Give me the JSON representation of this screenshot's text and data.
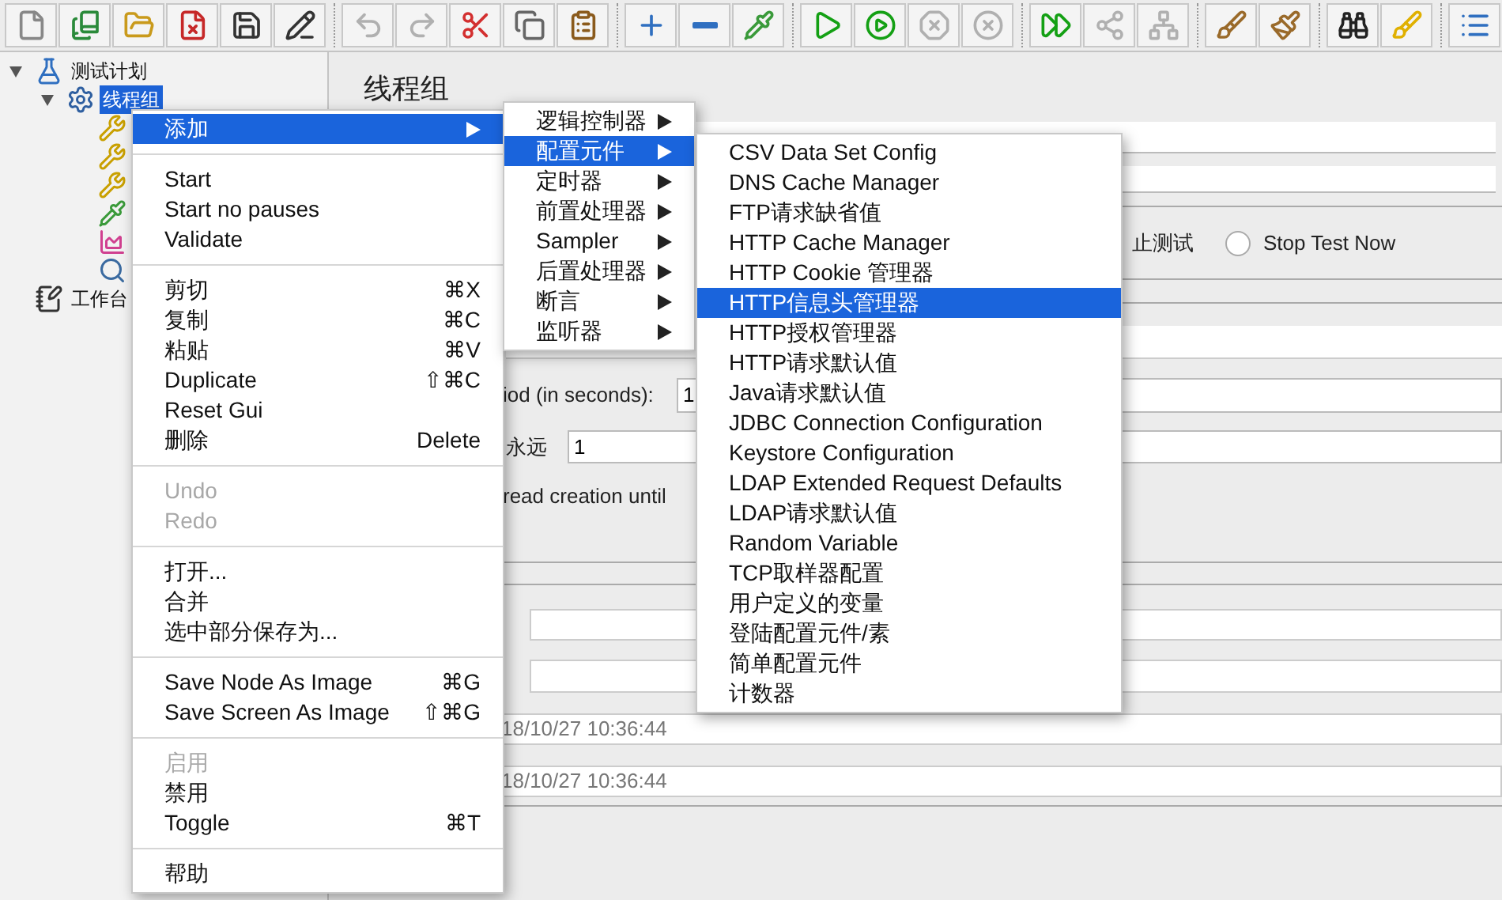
{
  "toolbar": [
    {
      "buttons": [
        {
          "kind": "new",
          "disabled": false
        },
        {
          "kind": "templates",
          "disabled": false
        },
        {
          "kind": "open",
          "disabled": false
        },
        {
          "kind": "close",
          "disabled": false
        },
        {
          "kind": "save",
          "disabled": false
        },
        {
          "kind": "save_as",
          "disabled": false
        }
      ]
    },
    {
      "buttons": [
        {
          "kind": "undo",
          "disabled": true
        },
        {
          "kind": "redo",
          "disabled": true
        },
        {
          "kind": "cut",
          "disabled": false
        },
        {
          "kind": "copy",
          "disabled": false
        },
        {
          "kind": "paste",
          "disabled": false
        }
      ]
    },
    {
      "buttons": [
        {
          "kind": "expand",
          "disabled": false
        },
        {
          "kind": "collapse",
          "disabled": false
        },
        {
          "kind": "toggle",
          "disabled": false
        }
      ]
    },
    {
      "buttons": [
        {
          "kind": "start",
          "disabled": false
        },
        {
          "kind": "start_no_pause",
          "disabled": false
        },
        {
          "kind": "stop",
          "disabled": true
        },
        {
          "kind": "shutdown",
          "disabled": true
        }
      ]
    },
    {
      "buttons": [
        {
          "kind": "remote_start",
          "disabled": false
        },
        {
          "kind": "remote_stop",
          "disabled": true
        },
        {
          "kind": "remote_exit",
          "disabled": true
        }
      ]
    },
    {
      "buttons": [
        {
          "kind": "clear",
          "disabled": false
        },
        {
          "kind": "clear_all",
          "disabled": false
        }
      ]
    },
    {
      "buttons": [
        {
          "kind": "search",
          "disabled": false
        },
        {
          "kind": "reset_search",
          "disabled": false
        }
      ]
    },
    {
      "buttons": [
        {
          "kind": "function_helper",
          "disabled": false
        }
      ]
    }
  ],
  "tree": [
    {
      "label": "测试计划",
      "kind": "plan",
      "expanded": true,
      "selected": false,
      "children": [
        {
          "label": "线程组",
          "kind": "thread_group",
          "expanded": true,
          "selected": true,
          "children": [
            {
              "kind": "sampler"
            },
            {
              "kind": "sampler"
            },
            {
              "kind": "sampler"
            },
            {
              "kind": "config"
            },
            {
              "kind": "chart"
            },
            {
              "kind": "magnifier"
            }
          ]
        }
      ]
    },
    {
      "label": "工作台",
      "kind": "workbench",
      "selected": false
    }
  ],
  "panel": {
    "title": "线程组",
    "action_label": "止测试",
    "radio": {
      "label": "Stop Test Now",
      "selected": false
    },
    "ramp_up": {
      "label": "iod (in seconds):",
      "value": "1"
    },
    "loop": {
      "label": "永远",
      "value": "1"
    },
    "delay_label": "read creation until",
    "start_time": "18/10/27 10:36:44",
    "end_time": "18/10/27 10:36:44"
  },
  "context_menu": [
    {
      "kind": "submenu",
      "label": "添加",
      "selected": true,
      "disabled": false
    },
    {
      "kind": "separator"
    },
    {
      "kind": "item",
      "label": "Start",
      "selected": false,
      "disabled": false
    },
    {
      "kind": "item",
      "label": "Start no pauses",
      "selected": false,
      "disabled": false
    },
    {
      "kind": "item",
      "label": "Validate",
      "selected": false,
      "disabled": false
    },
    {
      "kind": "separator"
    },
    {
      "kind": "item",
      "label": "剪切",
      "shortcut": "⌘X",
      "selected": false,
      "disabled": false
    },
    {
      "kind": "item",
      "label": "复制",
      "shortcut": "⌘C",
      "selected": false,
      "disabled": false
    },
    {
      "kind": "item",
      "label": "粘贴",
      "shortcut": "⌘V",
      "selected": false,
      "disabled": false
    },
    {
      "kind": "item",
      "label": "Duplicate",
      "shortcut": "⇧⌘C",
      "selected": false,
      "disabled": false
    },
    {
      "kind": "item",
      "label": "Reset Gui",
      "selected": false,
      "disabled": false
    },
    {
      "kind": "item",
      "label": "删除",
      "shortcut": "Delete",
      "selected": false,
      "disabled": false
    },
    {
      "kind": "separator"
    },
    {
      "kind": "item",
      "label": "Undo",
      "selected": false,
      "disabled": true
    },
    {
      "kind": "item",
      "label": "Redo",
      "selected": false,
      "disabled": true
    },
    {
      "kind": "separator"
    },
    {
      "kind": "item",
      "label": "打开...",
      "selected": false,
      "disabled": false
    },
    {
      "kind": "item",
      "label": "合并",
      "selected": false,
      "disabled": false
    },
    {
      "kind": "item",
      "label": "选中部分保存为...",
      "selected": false,
      "disabled": false
    },
    {
      "kind": "separator"
    },
    {
      "kind": "item",
      "label": "Save Node As Image",
      "shortcut": "⌘G",
      "selected": false,
      "disabled": false
    },
    {
      "kind": "item",
      "label": "Save Screen As Image",
      "shortcut": "⇧⌘G",
      "selected": false,
      "disabled": false
    },
    {
      "kind": "separator"
    },
    {
      "kind": "item",
      "label": "启用",
      "selected": false,
      "disabled": true
    },
    {
      "kind": "item",
      "label": "禁用",
      "selected": false,
      "disabled": false
    },
    {
      "kind": "item",
      "label": "Toggle",
      "shortcut": "⌘T",
      "selected": false,
      "disabled": false
    },
    {
      "kind": "separator"
    },
    {
      "kind": "item",
      "label": "帮助",
      "selected": false,
      "disabled": false
    }
  ],
  "add_menu": [
    {
      "kind": "submenu",
      "label": "逻辑控制器",
      "selected": false
    },
    {
      "kind": "submenu",
      "label": "配置元件",
      "selected": true
    },
    {
      "kind": "submenu",
      "label": "定时器",
      "selected": false
    },
    {
      "kind": "submenu",
      "label": "前置处理器",
      "selected": false
    },
    {
      "kind": "submenu",
      "label": "Sampler",
      "selected": false
    },
    {
      "kind": "submenu",
      "label": "后置处理器",
      "selected": false
    },
    {
      "kind": "submenu",
      "label": "断言",
      "selected": false
    },
    {
      "kind": "submenu",
      "label": "监听器",
      "selected": false
    }
  ],
  "config_menu": [
    {
      "kind": "item",
      "label": "CSV Data Set Config",
      "selected": false
    },
    {
      "kind": "item",
      "label": "DNS Cache Manager",
      "selected": false
    },
    {
      "kind": "item",
      "label": "FTP请求缺省值",
      "selected": false
    },
    {
      "kind": "item",
      "label": "HTTP Cache Manager",
      "selected": false
    },
    {
      "kind": "item",
      "label": "HTTP Cookie 管理器",
      "selected": false
    },
    {
      "kind": "item",
      "label": "HTTP信息头管理器",
      "selected": true
    },
    {
      "kind": "item",
      "label": "HTTP授权管理器",
      "selected": false
    },
    {
      "kind": "item",
      "label": "HTTP请求默认值",
      "selected": false
    },
    {
      "kind": "item",
      "label": "Java请求默认值",
      "selected": false
    },
    {
      "kind": "item",
      "label": "JDBC Connection Configuration",
      "selected": false
    },
    {
      "kind": "item",
      "label": "Keystore Configuration",
      "selected": false
    },
    {
      "kind": "item",
      "label": "LDAP Extended Request Defaults",
      "selected": false
    },
    {
      "kind": "item",
      "label": "LDAP请求默认值",
      "selected": false
    },
    {
      "kind": "item",
      "label": "Random Variable",
      "selected": false
    },
    {
      "kind": "item",
      "label": "TCP取样器配置",
      "selected": false
    },
    {
      "kind": "item",
      "label": "用户定义的变量",
      "selected": false
    },
    {
      "kind": "item",
      "label": "登陆配置元件/素",
      "selected": false
    },
    {
      "kind": "item",
      "label": "简单配置元件",
      "selected": false
    },
    {
      "kind": "item",
      "label": "计数器",
      "selected": false
    }
  ]
}
